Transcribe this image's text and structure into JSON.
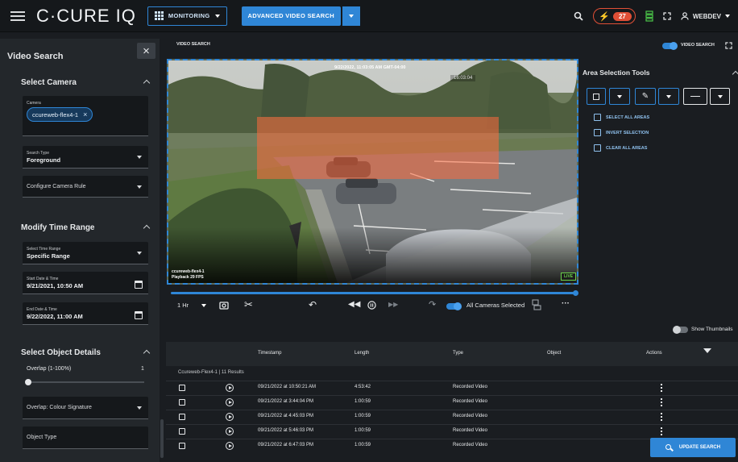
{
  "topbar": {
    "brand": "C·CURE IQ",
    "monitoring_label": "MONITORING",
    "advanced_label": "ADVANCED VIDEO SEARCH",
    "alert_count": "27",
    "user": "WEBDEV"
  },
  "left": {
    "title": "Video Search",
    "select_camera": {
      "heading": "Select Camera",
      "camera_label": "Camera",
      "camera_chip": "ccureweb-flex4-1",
      "search_type_label": "Search Type",
      "search_type_value": "Foreground",
      "configure_rule": "Configure Camera Rule"
    },
    "time_range": {
      "heading": "Modify Time Range",
      "select_label": "Select Time Range",
      "select_value": "Specific Range",
      "start_label": "Start Date & Time",
      "start_value": "9/21/2021, 10:50 AM",
      "end_label": "End Date & Time",
      "end_value": "9/22/2022, 11:00 AM"
    },
    "object_details": {
      "heading": "Select Object Details",
      "overlap_label": "Overlap (1-100%)",
      "overlap_value": "1",
      "overlap_type": "Overlap: Colour Signature",
      "object_type": "Object Type"
    }
  },
  "main": {
    "section_label": "VIDEO SEARCH",
    "video_search_toggle": "VIDEO SEARCH",
    "video": {
      "timestamp": "9/22/2022, 11:03:05 AM GMT-04:00",
      "clock": "16:03:04",
      "camera_name": "ccureweb-flex4-1",
      "playback": "Playback 29 FPS",
      "live": "LIVE"
    },
    "controls": {
      "range": "1 Hr",
      "all_cameras": "All Cameras Selected",
      "show_thumbnails": "Show Thumbnails"
    }
  },
  "area_tools": {
    "title": "Area Selection Tools",
    "select_all": "SELECT ALL AREAS",
    "invert": "INVERT SELECTION",
    "clear_all": "CLEAR ALL AREAS"
  },
  "table": {
    "headers": [
      "Timestamp",
      "Length",
      "Type",
      "Object",
      "Actions"
    ],
    "group": "Ccureweb-Flex4-1 | 11 Results",
    "rows": [
      {
        "timestamp": "09/21/2022 at 10:50:21 AM",
        "length": "4:53:42",
        "type": "Recorded Video"
      },
      {
        "timestamp": "09/21/2022 at 3:44:04 PM",
        "length": "1:00:59",
        "type": "Recorded Video"
      },
      {
        "timestamp": "09/21/2022 at 4:45:03 PM",
        "length": "1:00:59",
        "type": "Recorded Video"
      },
      {
        "timestamp": "09/21/2022 at 5:46:03 PM",
        "length": "1:00:59",
        "type": "Recorded Video"
      },
      {
        "timestamp": "09/21/2022 at 6:47:03 PM",
        "length": "1:00:59",
        "type": "Recorded Video"
      }
    ]
  },
  "update_button": "UPDATE SEARCH"
}
